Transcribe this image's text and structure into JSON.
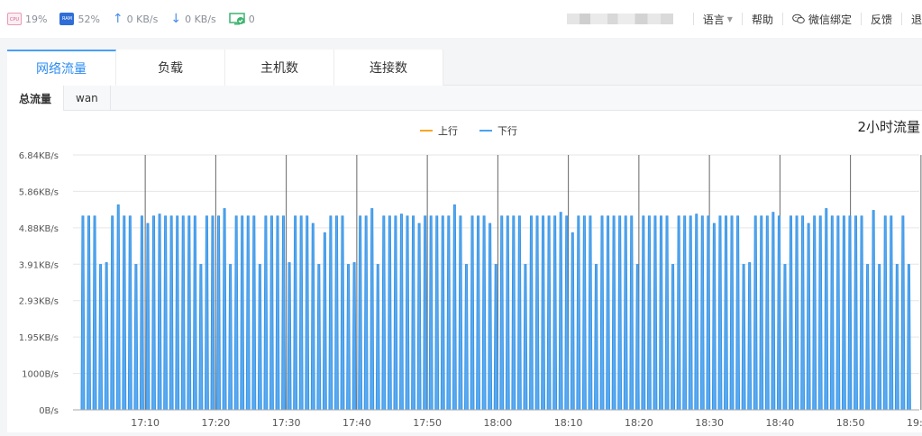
{
  "topbar": {
    "cpu": {
      "chip": "CPU",
      "value": "19%"
    },
    "ram": {
      "chip": "RAM",
      "value": "52%"
    },
    "upload": {
      "value": "0 KB/s"
    },
    "download": {
      "value": "0 KB/s"
    },
    "sites": {
      "value": "0"
    },
    "menu": {
      "language": "语言",
      "help": "帮助",
      "wechat": "微信绑定",
      "feedback": "反馈",
      "logout": "退"
    }
  },
  "tabs": [
    {
      "label": "网络流量",
      "active": true
    },
    {
      "label": "负载",
      "active": false
    },
    {
      "label": "主机数",
      "active": false
    },
    {
      "label": "连接数",
      "active": false
    }
  ],
  "subtabs": [
    {
      "label": "总流量",
      "active": true
    },
    {
      "label": "wan",
      "active": false
    }
  ],
  "chart_data": {
    "type": "area",
    "title": "2小时流量",
    "series": [
      {
        "name": "上行",
        "color": "#f5a623",
        "values": []
      },
      {
        "name": "下行",
        "color": "#4aa3f0"
      }
    ],
    "x_tick_labels": [
      "17:10",
      "17:20",
      "17:30",
      "17:40",
      "17:50",
      "18:00",
      "18:10",
      "18:20",
      "18:30",
      "18:40",
      "18:50",
      "19:00"
    ],
    "y_tick_labels": [
      "0B/s",
      "1000B/s",
      "1.95KB/s",
      "2.93KB/s",
      "3.91KB/s",
      "4.88KB/s",
      "5.86KB/s",
      "6.84KB/s"
    ],
    "y_range_kbps": [
      0,
      6.84
    ],
    "x_range_minutes": [
      "17:05",
      "19:05"
    ],
    "pattern": {
      "description": "burst",
      "peak_values_kbps": [
        5.2,
        5.2,
        5.2,
        3.9,
        3.95,
        5.2,
        5.5,
        5.2,
        5.2,
        3.9,
        5.2,
        5.0,
        5.2,
        5.25,
        5.2,
        5.2,
        5.2,
        5.2,
        5.2,
        5.2,
        3.9,
        5.2,
        5.2,
        5.2,
        5.4,
        3.9,
        5.2,
        5.2,
        5.2,
        5.2,
        3.9,
        5.2,
        5.2,
        5.2,
        5.2,
        3.95,
        5.2,
        5.2,
        5.2,
        5.0,
        3.9,
        4.75,
        5.2,
        5.2,
        5.2,
        3.9,
        3.95,
        5.2,
        5.2,
        5.4,
        3.9,
        5.2,
        5.2,
        5.2,
        5.25,
        5.2,
        5.2,
        5.0,
        5.2,
        5.2,
        5.2,
        5.2,
        5.2,
        5.5,
        5.2,
        3.9,
        5.2,
        5.2,
        5.2,
        5.0,
        3.9,
        5.2,
        5.2,
        5.2,
        5.2,
        3.9,
        5.2,
        5.2,
        5.2,
        5.2,
        5.2,
        5.3,
        5.2,
        4.75,
        5.2,
        5.2,
        5.2,
        3.9,
        5.2,
        5.2,
        5.2,
        5.2,
        5.2,
        5.2,
        3.9,
        5.2,
        5.2,
        5.2,
        5.2,
        5.2,
        3.9,
        5.2,
        5.2,
        5.2,
        5.25,
        5.2,
        5.2,
        5.0,
        5.2,
        5.2,
        5.2,
        5.2,
        3.9,
        3.95,
        5.2,
        5.2,
        5.2,
        5.3,
        5.2,
        3.9,
        5.2,
        5.2,
        5.2,
        5.0,
        5.2,
        5.2,
        5.4,
        5.2,
        5.2,
        5.2,
        5.2,
        5.2,
        5.2,
        3.9,
        5.35,
        3.9,
        5.2,
        5.2,
        3.9,
        5.2,
        3.9
      ]
    }
  }
}
